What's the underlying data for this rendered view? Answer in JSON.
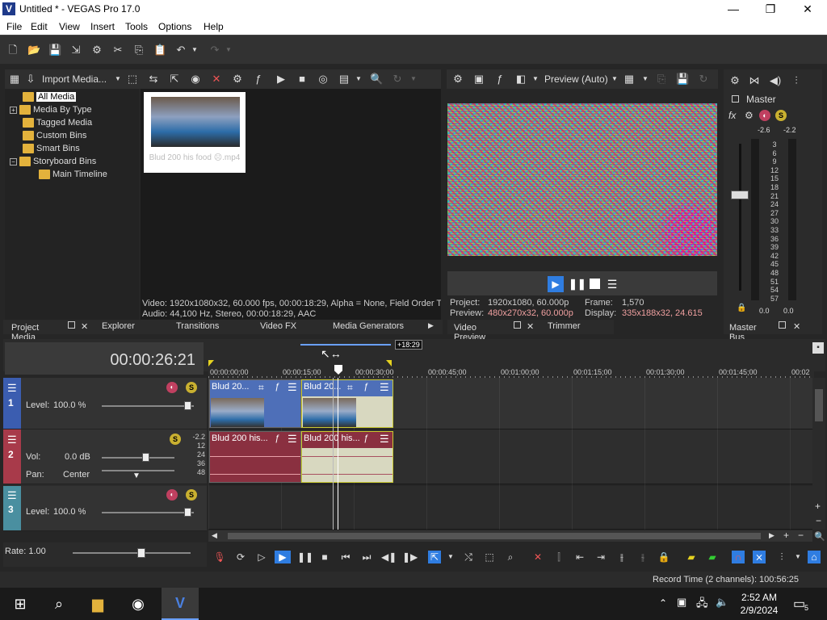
{
  "window": {
    "title": "Untitled * - VEGAS Pro 17.0",
    "logo": "V",
    "minimize": "—",
    "maximize": "❐",
    "close": "✕"
  },
  "menu": [
    "File",
    "Edit",
    "View",
    "Insert",
    "Tools",
    "Options",
    "Help"
  ],
  "project_media": {
    "import_label": "Import Media...",
    "tree": [
      {
        "label": "All Media",
        "selected": true
      },
      {
        "label": "Media By Type",
        "expander": "+"
      },
      {
        "label": "Tagged Media"
      },
      {
        "label": "Custom Bins"
      },
      {
        "label": "Smart Bins"
      },
      {
        "label": "Storyboard Bins",
        "expander": "−"
      },
      {
        "label": "Main Timeline"
      }
    ],
    "thumb_caption": "Blud 200 his food ☹.mp4",
    "info_video": "Video: 1920x1080x32, 60.000 fps, 00:00:18:29, Alpha = None, Field Order T",
    "info_audio": "Audio: 44,100 Hz, Stereo, 00:00:18:29, AAC"
  },
  "dock_tabs": {
    "project_media": "Project Media",
    "explorer": "Explorer",
    "transitions": "Transitions",
    "video_fx": "Video FX",
    "media_generators": "Media Generators",
    "video_preview": "Video Preview",
    "trimmer": "Trimmer",
    "master_bus": "Master Bus"
  },
  "preview": {
    "mode": "Preview (Auto)",
    "project_label": "Project:",
    "project_value": "1920x1080, 60.000p",
    "frame_label": "Frame:",
    "frame_value": "1,570",
    "preview_label": "Preview:",
    "preview_value": "480x270x32, 60.000p",
    "display_label": "Display:",
    "display_value": "335x188x32, 24.615"
  },
  "master": {
    "title": "Master",
    "peak_left": "-2.6",
    "peak_right": "-2.2",
    "scale": [
      "3",
      "6",
      "9",
      "12",
      "15",
      "18",
      "21",
      "24",
      "27",
      "30",
      "33",
      "36",
      "39",
      "42",
      "45",
      "48",
      "51",
      "54",
      "57"
    ],
    "bottom_left": "0.0",
    "bottom_right": "0.0"
  },
  "timeline": {
    "timecode": "00:00:26:21",
    "region_length": "+18:29",
    "ruler": [
      "00:00:00;00",
      "00:00:15;00",
      "00:00:30;00",
      "00:00:45;00",
      "00:01:00;00",
      "00:01:15;00",
      "00:01:30;00",
      "00:01:45;00",
      "00:02"
    ],
    "tracks": [
      {
        "num": "1",
        "level_label": "Level:",
        "level_value": "100.0 %",
        "color": "#3b5db0"
      },
      {
        "num": "2",
        "vol_label": "Vol:",
        "vol_value": "0.0 dB",
        "pan_label": "Pan:",
        "pan_value": "Center",
        "color": "#a83a4a",
        "meter_top": "-2.2",
        "meter_scale": [
          "12",
          "24",
          "36",
          "48"
        ]
      },
      {
        "num": "3",
        "level_label": "Level:",
        "level_value": "100.0 %",
        "color": "#4a8fa0"
      }
    ],
    "clips": {
      "video1": "Blud 20...",
      "video2": "Blud 20...",
      "audio1": "Blud 200 his...",
      "audio2": "Blud 200 his..."
    },
    "rate_label": "Rate: 1.00"
  },
  "status": {
    "record_time": "Record Time (2 channels): 100:56:25"
  },
  "taskbar": {
    "time": "2:52 AM",
    "date": "2/9/2024",
    "notifications": "5"
  }
}
